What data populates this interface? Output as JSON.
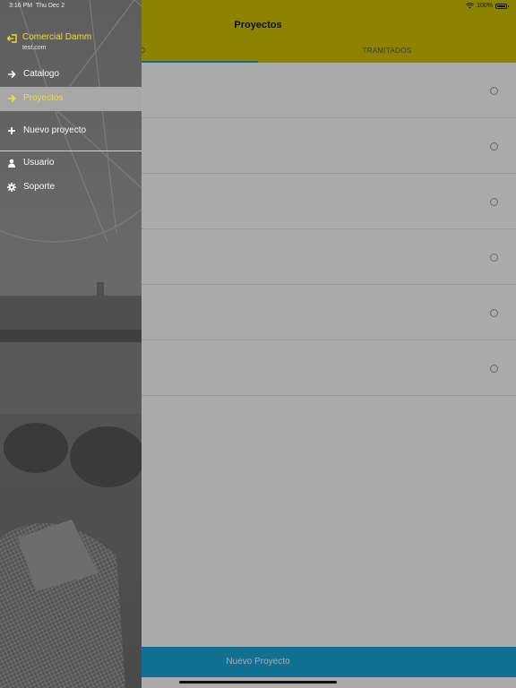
{
  "status_bar": {
    "time": "3:16 PM",
    "date": "Thu Dec 2",
    "battery": "100%",
    "wifi_icon": "wifi-icon",
    "battery_icon": "battery-icon"
  },
  "header": {
    "title": "Proyectos",
    "tabs": [
      {
        "label": "O",
        "active": true
      },
      {
        "label": "TRAMITADOS",
        "active": false
      }
    ]
  },
  "list": {
    "rows": [
      {
        "selected": false
      },
      {
        "selected": false
      },
      {
        "selected": false
      },
      {
        "selected": false
      },
      {
        "selected": false
      },
      {
        "selected": false
      }
    ]
  },
  "footer": {
    "new_project_label": "Nuevo Proyecto"
  },
  "drawer": {
    "user": {
      "name": "Comercial Damm",
      "email": "test.com",
      "icon": "logout-icon"
    },
    "menu": [
      {
        "label": "Catalogo",
        "icon": "arrow-right-icon",
        "active": false
      },
      {
        "label": "Proyectos",
        "icon": "arrow-right-icon",
        "active": true
      },
      {
        "label": "Nuevo proyecto",
        "icon": "plus-icon",
        "active": false
      },
      {
        "label": "Usuario",
        "icon": "user-icon",
        "active": false
      },
      {
        "label": "Soporte",
        "icon": "gear-icon",
        "active": false
      }
    ]
  },
  "colors": {
    "header_yellow": "#d4c400",
    "accent_yellow": "#f1df2e",
    "tab_indicator": "#2a9fc5",
    "button_blue": "#1aa9dc",
    "drawer_active": "#a7a7a7"
  }
}
